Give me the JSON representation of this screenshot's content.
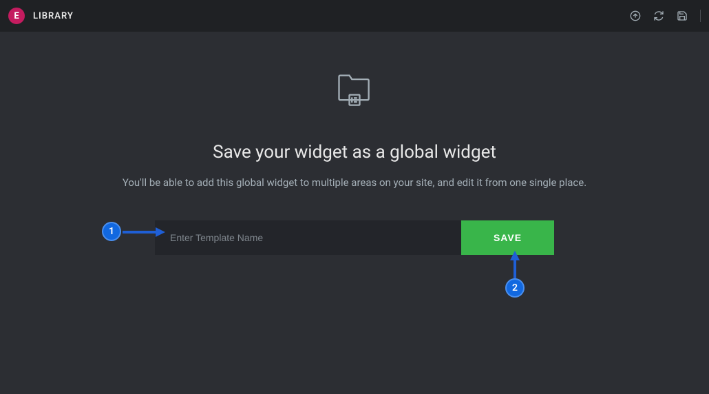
{
  "header": {
    "logo_text": "E",
    "title": "LIBRARY"
  },
  "content": {
    "heading": "Save your widget as a global widget",
    "subheading": "You'll be able to add this global widget to multiple areas on your site, and edit it from one single place.",
    "input_placeholder": "Enter Template Name",
    "save_button": "SAVE"
  },
  "annotations": {
    "badge1": "1",
    "badge2": "2"
  }
}
